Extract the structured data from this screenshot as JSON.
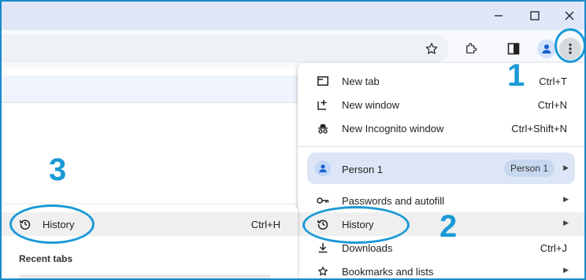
{
  "window_controls": {
    "minimize_icon": "minimize-icon",
    "maximize_icon": "maximize-icon",
    "close_icon": "close-icon"
  },
  "toolbar": {
    "icons": [
      "star-icon",
      "extensions-icon",
      "side-panel-icon",
      "profile-icon",
      "more-vert-icon"
    ]
  },
  "menu": {
    "items_top": [
      {
        "label": "New tab",
        "shortcut": "Ctrl+T",
        "icon": "new-tab-icon"
      },
      {
        "label": "New window",
        "shortcut": "Ctrl+N",
        "icon": "new-window-icon"
      },
      {
        "label": "New Incognito window",
        "shortcut": "Ctrl+Shift+N",
        "icon": "incognito-icon"
      }
    ],
    "profile": {
      "label": "Person 1",
      "chip": "Person 1"
    },
    "items_bottom": [
      {
        "label": "Passwords and autofill",
        "icon": "key-icon"
      },
      {
        "label": "History",
        "icon": "history-icon"
      },
      {
        "label": "Downloads",
        "shortcut": "Ctrl+J",
        "icon": "download-icon"
      },
      {
        "label": "Bookmarks and lists",
        "icon": "star-icon"
      }
    ]
  },
  "history_submenu": {
    "item": {
      "label": "History",
      "shortcut": "Ctrl+H"
    },
    "section_title": "Recent tabs"
  },
  "annotations": {
    "n1": "1",
    "n2": "2",
    "n3": "3"
  },
  "colors": {
    "annotation": "#1a9ad6",
    "titlebar": "#dfe7f8",
    "menu_hover": "#efeff0",
    "profile_bg": "#dde6f6"
  }
}
